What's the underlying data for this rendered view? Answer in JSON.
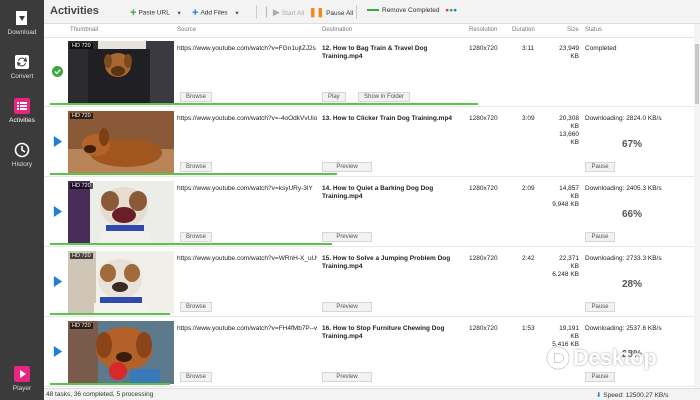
{
  "sidebar": {
    "items": [
      {
        "label": "Download",
        "icon": "download-icon"
      },
      {
        "label": "Convert",
        "icon": "convert-icon"
      },
      {
        "label": "Activities",
        "icon": "activities-icon",
        "active": true
      },
      {
        "label": "History",
        "icon": "history-icon"
      },
      {
        "label": "Player",
        "icon": "player-icon"
      }
    ],
    "accent": "#e8257f"
  },
  "toolbar": {
    "title": "Activities",
    "paste_url": "Paste URL",
    "add_files": "Add Files",
    "start_all": "Start All",
    "pause_all": "Pause All",
    "remove_completed": "Remove Completed"
  },
  "columns": {
    "thumbnail": "Thumbnail",
    "source": "Source",
    "destination": "Destination",
    "resolution": "Resolution",
    "duration": "Duration",
    "size": "Size",
    "status": "Status"
  },
  "rows": [
    {
      "quality": "HD 720",
      "source": "https://www.youtube.com/watch?v=FGn1ujtZJ2s",
      "destination": "12. How to Bag Train & Travel  Dog Training.mp4",
      "resolution": "1280x720",
      "duration": "3:11",
      "size_line1": "23,949 KB",
      "size_line2": "",
      "status": "Completed",
      "percent": "",
      "buttons": [
        "Browse",
        "Play",
        "Show in Folder"
      ],
      "progress": 1.0
    },
    {
      "quality": "HD 720",
      "source": "https://www.youtube.com/watch?v=-4oOdkVvUio",
      "destination": "13. How to Clicker Train  Dog Training.mp4",
      "resolution": "1280x720",
      "duration": "3:09",
      "size_line1": "20,308 KB",
      "size_line2": "13,660 KB",
      "status": "Downloading: 2824.0 KB/s",
      "percent": "67%",
      "buttons": [
        "Browse",
        "Preview",
        "Pause"
      ],
      "progress": 0.67
    },
    {
      "quality": "HD 720",
      "source": "https://www.youtube.com/watch?v=ksyURy-3lY",
      "destination": "14. How to Quiet a Barking Dog  Dog Training.mp4",
      "resolution": "1280x720",
      "duration": "2:09",
      "size_line1": "14,857 KB",
      "size_line2": "9,948 KB",
      "status": "Downloading: 2405.3 KB/s",
      "percent": "66%",
      "buttons": [
        "Browse",
        "Preview",
        "Pause"
      ],
      "progress": 0.66
    },
    {
      "quality": "HD 720",
      "source": "https://www.youtube.com/watch?v=WRnH-X_uUv8",
      "destination": "15. How to Solve a Jumping Problem  Dog Training.mp4",
      "resolution": "1280x720",
      "duration": "2:42",
      "size_line1": "22,371 KB",
      "size_line2": "6,248 KB",
      "status": "Downloading: 2733.3 KB/s",
      "percent": "28%",
      "buttons": [
        "Browse",
        "Preview",
        "Pause"
      ],
      "progress": 0.28
    },
    {
      "quality": "HD 720",
      "source": "https://www.youtube.com/watch?v=FH4fMb7P--w",
      "destination": "16. How to Stop Furniture Chewing  Dog Training.mp4",
      "resolution": "1280x720",
      "duration": "1:53",
      "size_line1": "19,191 KB",
      "size_line2": "5,416 KB",
      "status": "Downloading: 2537.6 KB/s",
      "percent": "28%",
      "buttons": [
        "Browse",
        "Preview",
        "Pause"
      ],
      "progress": 0.28
    }
  ],
  "statusbar": {
    "tasks": "48 tasks, 36 completed, 5 processing",
    "speed": "Speed: 12500.27 KB/s"
  },
  "watermark": "Desktop",
  "colors": {
    "progress": "#5bc24a",
    "play_arrow": "#1e7fd6",
    "completed": "#3aa83a"
  }
}
